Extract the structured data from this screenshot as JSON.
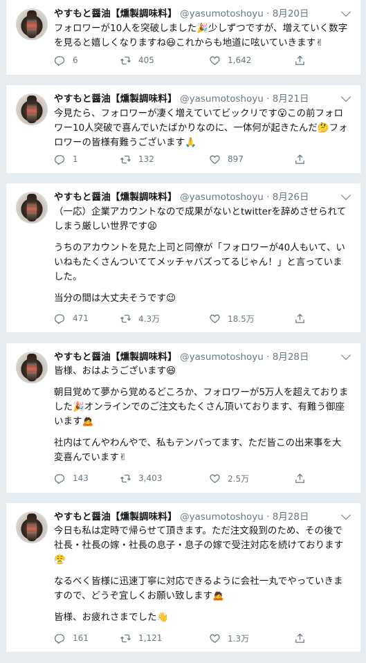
{
  "tweets": [
    {
      "name": "やすもと醤油【燻製調味料】",
      "handle": "@yasumotoshoyu",
      "sep": " · ",
      "date": "8月20日",
      "paragraphs": [
        "フォロワーが10人を突破しました🎉少しずつですが、増えていく数字を見ると嬉しくなりますね😆これからも地道に呟いていきます✌"
      ],
      "replies": "6",
      "retweets": "405",
      "likes": "1,642"
    },
    {
      "name": "やすもと醤油【燻製調味料】",
      "handle": "@yasumotoshoyu",
      "sep": " · ",
      "date": "8月21日",
      "paragraphs": [
        "今見たら、フォロワーが凄く増えていてビックリです😮この前フォロワー10人突破で喜んでいたばかりなのに、一体何が起きたんだ🤔フォロワーの皆様有難うございます🙏"
      ],
      "replies": "1",
      "retweets": "132",
      "likes": "897"
    },
    {
      "name": "やすもと醤油【燻製調味料】",
      "handle": "@yasumotoshoyu",
      "sep": " · ",
      "date": "8月26日",
      "paragraphs": [
        "（一応）企業アカウントなので成果がないとtwitterを辞めさせられてしまう厳しい世界です😫",
        "うちのアカウントを見た上司と同僚が「フォロワーが40人もいて、いいねもたくさんついててメッチャバズってるじゃん！」と言っていました。",
        "当分の間は大丈夫そうです😉"
      ],
      "replies": "471",
      "retweets": "4.3万",
      "likes": "18.5万"
    },
    {
      "name": "やすもと醤油【燻製調味料】",
      "handle": "@yasumotoshoyu",
      "sep": " · ",
      "date": "8月28日",
      "paragraphs": [
        "皆様、おはようございます😆",
        "朝目覚めて夢から覚めるどころか、フォロワーが5万人を超えておりました🎉オンラインでのご注文もたくさん頂いております、有難う御座います🙇",
        "社内はてんやわんやで、私もテンパってます、ただ皆この出来事を大変喜んでいます✌"
      ],
      "replies": "143",
      "retweets": "3,403",
      "likes": "2.5万"
    },
    {
      "name": "やすもと醤油【燻製調味料】",
      "handle": "@yasumotoshoyu",
      "sep": " · ",
      "date": "8月28日",
      "paragraphs": [
        "今日も私は定時で帰らせて頂きます。ただ注文殺到のため、その後で社長・社長の嫁・社長の息子・息子の嫁で受注対応を続けております😤",
        "なるべく皆様に迅速丁寧に対応できるように会社一丸でやっていきますので、どうぞ宜しくお願い致します🙇",
        "皆様、お疲れさまでした👋"
      ],
      "replies": "161",
      "retweets": "1,121",
      "likes": "1.3万"
    }
  ],
  "icons": {
    "reply": "reply-icon",
    "retweet": "retweet-icon",
    "like": "like-icon",
    "share": "share-icon",
    "more": "chevron-down-icon"
  },
  "colors": {
    "background": "#e6ecf0",
    "card": "#ffffff",
    "text": "#14171a",
    "muted": "#657786"
  }
}
